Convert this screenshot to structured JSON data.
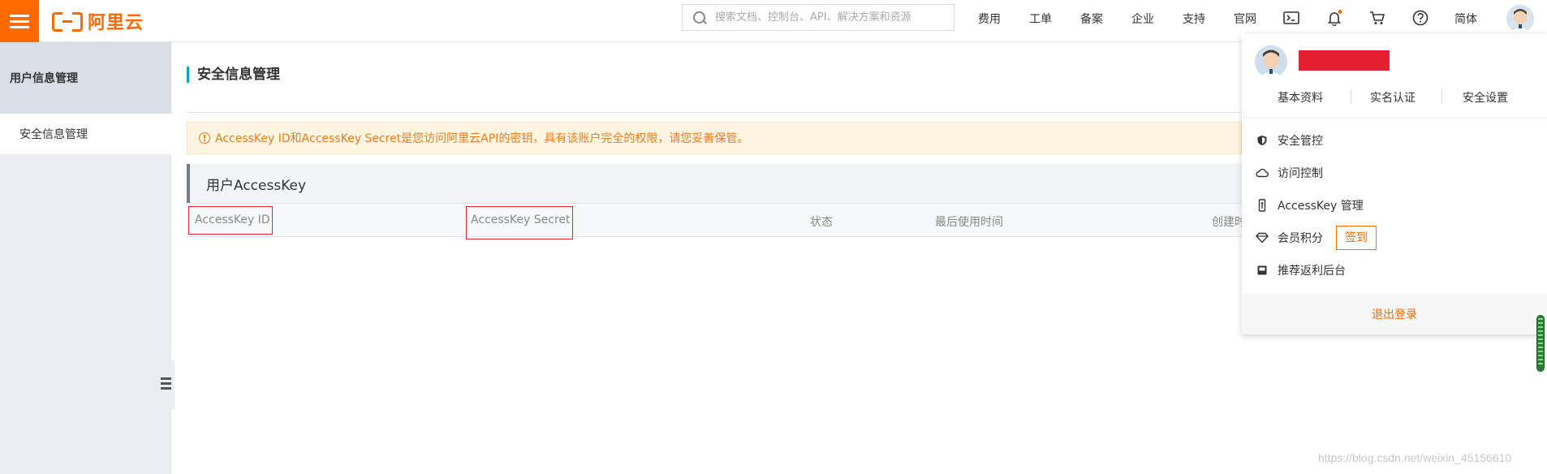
{
  "header": {
    "logo_text": "阿里云",
    "search_placeholder": "搜索文档、控制台、API、解决方案和资源",
    "nav": [
      "费用",
      "工单",
      "备案",
      "企业",
      "支持",
      "官网"
    ],
    "lang": "简体",
    "icons": [
      "menu-icon",
      "terminal-icon",
      "bell-icon",
      "cart-icon",
      "help-icon"
    ],
    "accent": "#ff6a00"
  },
  "sidebar": {
    "group": "用户信息管理",
    "items": [
      "安全信息管理"
    ]
  },
  "main": {
    "title": "安全信息管理",
    "notice": "AccessKey ID和AccessKey Secret是您访问阿里云API的密钥，具有该账户完全的权限，请您妥善保管。",
    "section": "用户AccessKey",
    "columns": [
      "AccessKey ID",
      "AccessKey Secret",
      "状态",
      "最后使用时间",
      "创建时"
    ]
  },
  "dropdown": {
    "tabs": [
      "基本资料",
      "实名认证",
      "安全设置"
    ],
    "items": [
      {
        "label": "安全管控",
        "icon": "shield-icon"
      },
      {
        "label": "访问控制",
        "icon": "cloud-icon"
      },
      {
        "label": "AccessKey 管理",
        "icon": "key-icon"
      },
      {
        "label": "会员积分",
        "icon": "diamond-icon"
      },
      {
        "label": "推荐返利后台",
        "icon": "gift-icon"
      }
    ],
    "signin": "签到",
    "logout": "退出登录"
  },
  "watermark": "https://blog.csdn.net/weixin_45156610"
}
